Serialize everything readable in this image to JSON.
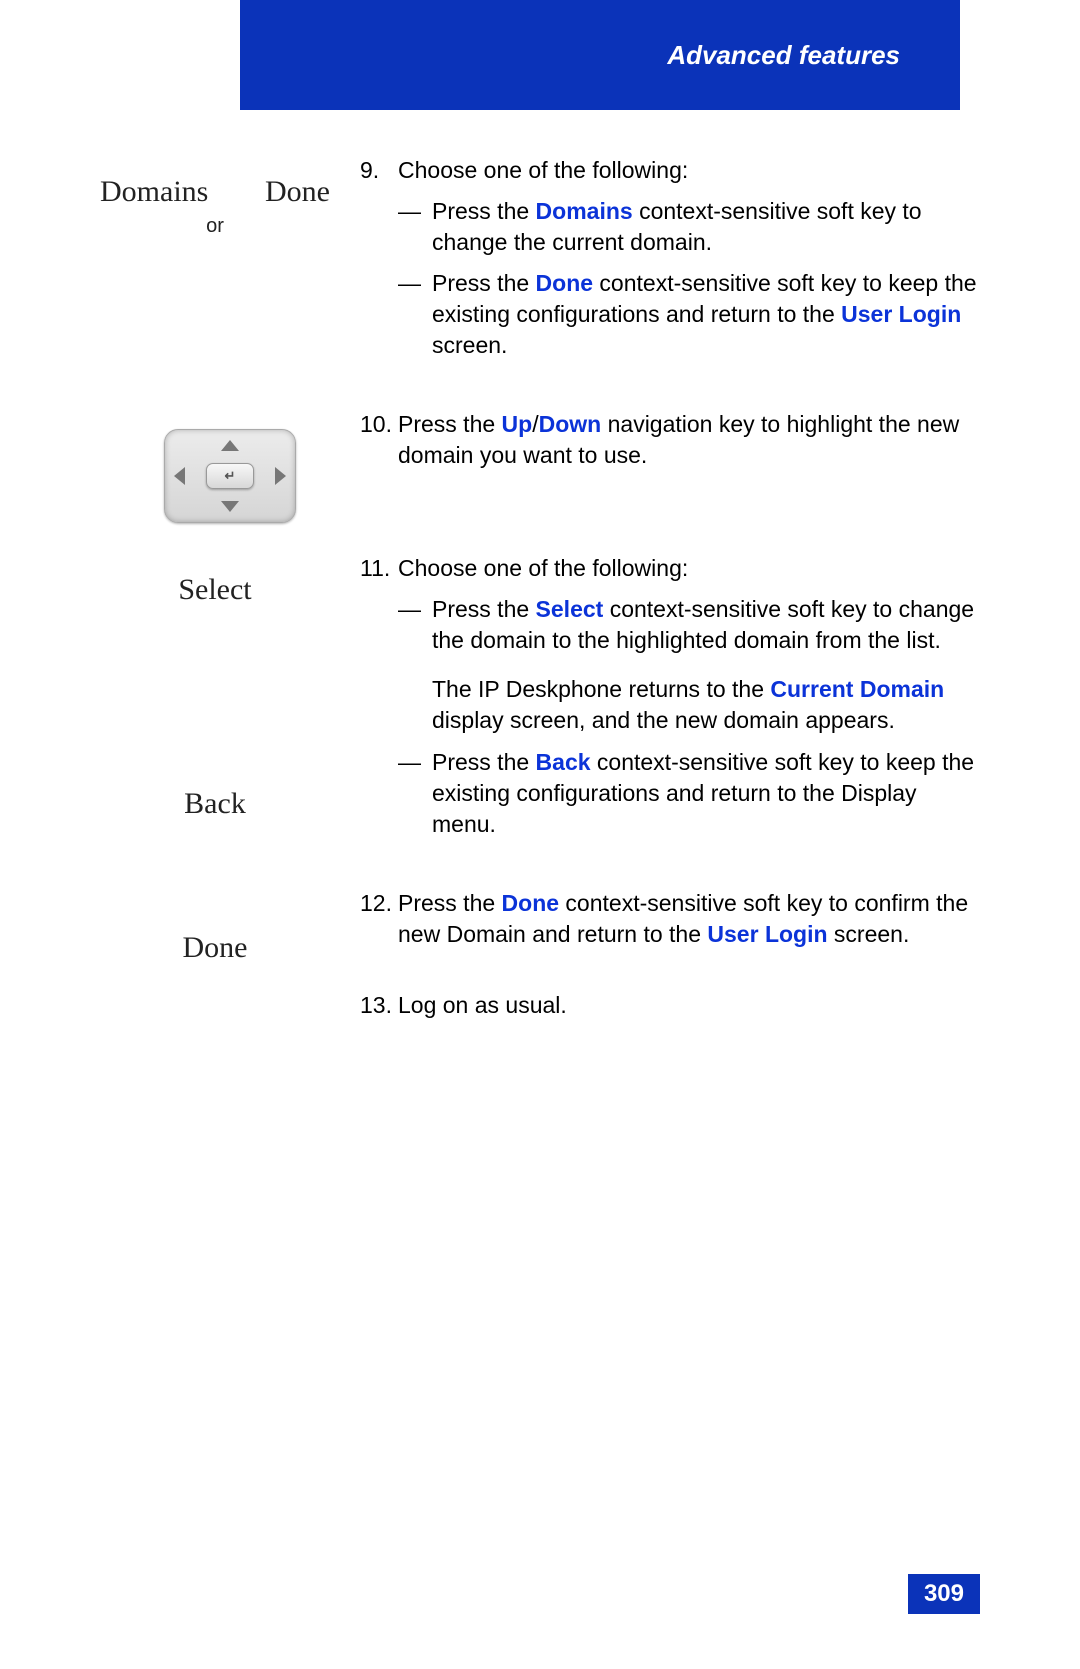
{
  "header": {
    "title": "Advanced features"
  },
  "page_number": "309",
  "left": {
    "domains": "Domains",
    "done": "Done",
    "or": "or",
    "select": "Select",
    "back": "Back",
    "done2": "Done"
  },
  "steps": {
    "s9": {
      "num": "9.",
      "lead": "Choose one of the following:",
      "a_pre": "Press the ",
      "a_link": "Domains",
      "a_post": " context-sensitive soft key to change the current domain.",
      "b_pre": "Press the ",
      "b_link": "Done",
      "b_mid": " context-sensitive soft key to keep the existing configurations and return to the ",
      "b_link2": "User Login",
      "b_post": " screen."
    },
    "s10": {
      "num": "10.",
      "pre": "Press the ",
      "link1": "Up",
      "slash": "/",
      "link2": "Down",
      "post": " navigation key to highlight the new domain you want to use."
    },
    "s11": {
      "num": "11.",
      "lead": "Choose one of the following:",
      "a_pre": "Press the ",
      "a_link": "Select",
      "a_post": " context-sensitive soft key to change the domain to the highlighted domain from the list.",
      "mid_pre": "The IP Deskphone returns to the ",
      "mid_link": "Current Domain",
      "mid_post": " display screen, and the new domain appears.",
      "b_pre": "Press the ",
      "b_link": "Back",
      "b_post": " context-sensitive soft key to keep the existing configurations and return to the Display menu."
    },
    "s12": {
      "num": "12.",
      "pre": "Press the ",
      "link": "Done",
      "mid": " context-sensitive soft key to confirm the new Domain and return to the ",
      "link2": "User Login",
      "post": " screen."
    },
    "s13": {
      "num": "13.",
      "text": " Log on as usual."
    }
  }
}
